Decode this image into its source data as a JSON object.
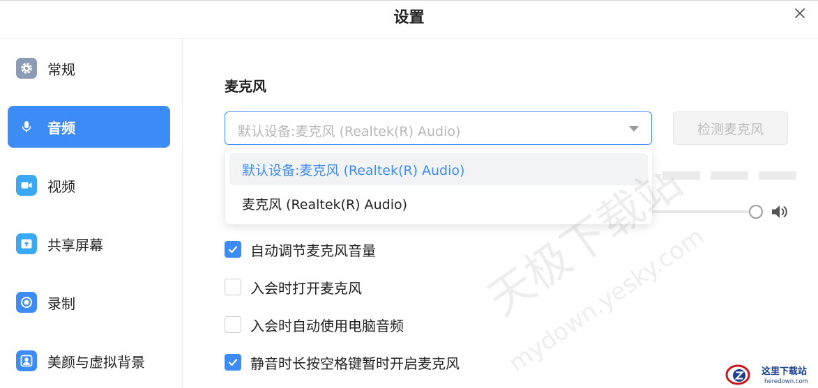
{
  "window": {
    "title": "设置"
  },
  "sidebar": {
    "items": [
      {
        "label": "常规",
        "icon": "gear-icon",
        "color": "#8a9bb5"
      },
      {
        "label": "音频",
        "icon": "microphone-icon",
        "color": "#3d8bf7"
      },
      {
        "label": "视频",
        "icon": "video-camera-icon",
        "color": "#3aa8f5"
      },
      {
        "label": "共享屏幕",
        "icon": "share-screen-icon",
        "color": "#3aa8f5"
      },
      {
        "label": "录制",
        "icon": "record-icon",
        "color": "#3d8bf7"
      },
      {
        "label": "美颜与虚拟背景",
        "icon": "portrait-icon",
        "color": "#3d8bf7"
      }
    ],
    "active_index": 1
  },
  "microphone": {
    "section_title": "麦克风",
    "select_value": "默认设备:麦克风 (Realtek(R) Audio)",
    "test_button": "检测麦克风",
    "options": [
      {
        "label": "默认设备:麦克风 (Realtek(R) Audio)",
        "selected": true
      },
      {
        "label": "麦克风 (Realtek(R) Audio)",
        "selected": false
      }
    ],
    "input_volume_level": 1.0
  },
  "checkboxes": [
    {
      "label": "自动调节麦克风音量",
      "checked": true
    },
    {
      "label": "入会时打开麦克风",
      "checked": false
    },
    {
      "label": "入会时自动使用电脑音频",
      "checked": false
    },
    {
      "label": "静音时长按空格键暂时开启麦克风",
      "checked": true
    }
  ],
  "watermark": {
    "line1": "天极下载站",
    "line2": "mydown.yesky.com"
  },
  "logo": {
    "line1": "这里下载站",
    "line2": "heredown.com"
  },
  "colors": {
    "accent": "#3d8bf7",
    "text": "#222222",
    "muted": "#b8b8b8"
  }
}
